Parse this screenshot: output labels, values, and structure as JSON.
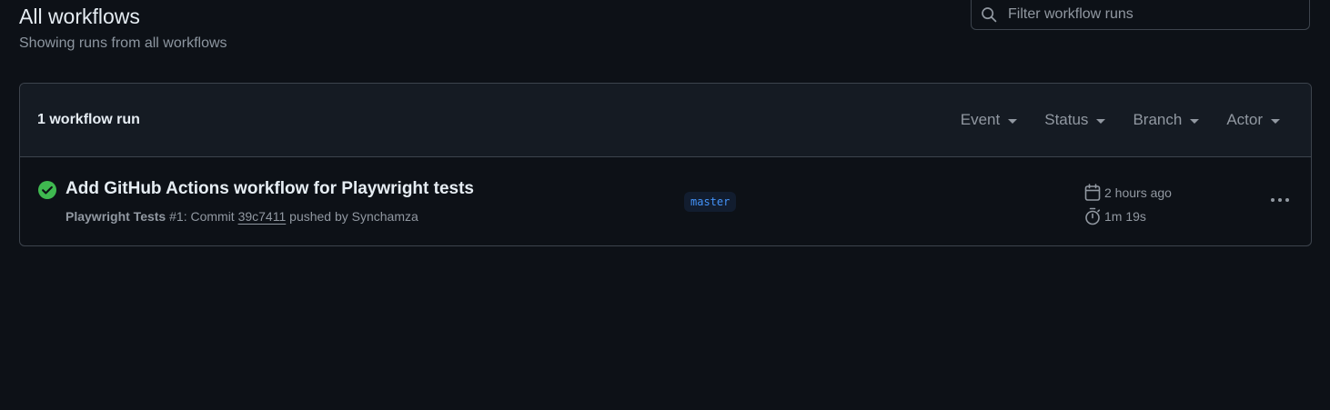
{
  "page": {
    "title": "All workflows",
    "subtitle": "Showing runs from all workflows"
  },
  "search": {
    "placeholder": "Filter workflow runs",
    "value": ""
  },
  "runs_header": {
    "count_label": "1 workflow run",
    "filters": [
      {
        "label": "Event"
      },
      {
        "label": "Status"
      },
      {
        "label": "Branch"
      },
      {
        "label": "Actor"
      }
    ]
  },
  "runs": [
    {
      "status": "success",
      "status_icon": "check-circle-fill-icon",
      "title": "Add GitHub Actions workflow for Playwright tests",
      "workflow_name": "Playwright Tests",
      "run_number": "#1",
      "meta_commit_prefix": ": Commit ",
      "commit_sha": "39c7411",
      "meta_suffix": " pushed by Synchamza",
      "branch": "master",
      "started": "2 hours ago",
      "duration": "1m 19s"
    }
  ],
  "colors": {
    "background": "#0d1117",
    "header_bg": "#151b23",
    "border": "#3d444d",
    "success": "#3fb950",
    "branch_fg": "#4493f8",
    "branch_bg": "#121d2f",
    "muted": "#9198a1"
  }
}
